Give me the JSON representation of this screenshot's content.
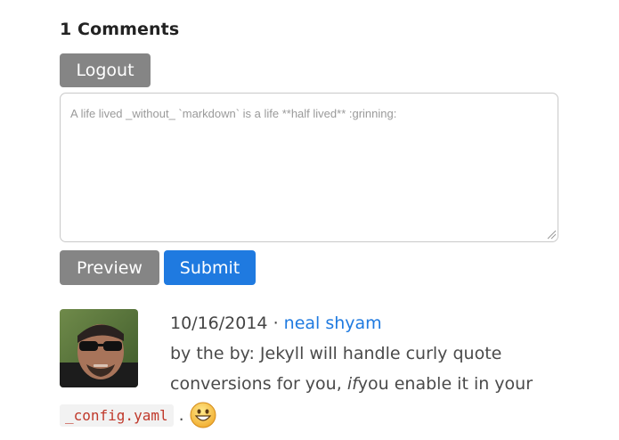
{
  "comments": {
    "heading": "1 Comments",
    "logout_label": "Logout",
    "textarea_placeholder": "A life lived _without_ `markdown` is a life **half lived** :grinning:",
    "preview_label": "Preview",
    "submit_label": "Submit"
  },
  "comment": {
    "date": "10/16/2014",
    "separator": "·",
    "author": "neal shyam",
    "text_part1": "by the by: Jekyll will handle curly quote",
    "text_part2": "conversions for you,",
    "text_italic": "if",
    "text_part3": "you enable it in your",
    "code": "_config.yaml",
    "period": ".",
    "emoji_icon": "grinning-face-icon",
    "avatar_icon": "user-avatar"
  },
  "colors": {
    "accent": "#1f7ae0",
    "button_gray": "#858585",
    "code_red": "#c0392b"
  }
}
